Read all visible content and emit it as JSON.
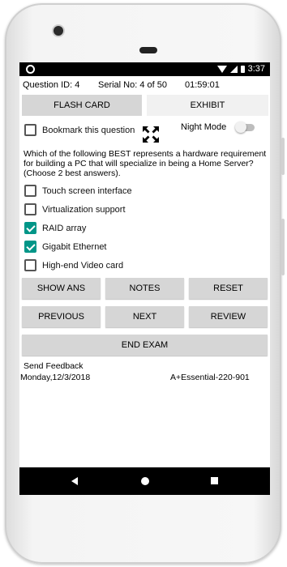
{
  "status_bar": {
    "time": "3:37"
  },
  "info": {
    "question_id": "Question ID: 4",
    "serial_no": "Serial No: 4 of 50",
    "timer": "01:59:01"
  },
  "tabs": {
    "flash_card": "FLASH CARD",
    "exhibit": "EXHIBIT"
  },
  "bookmark": {
    "label": "Bookmark this question",
    "checked": false
  },
  "night_mode": {
    "label": "Night Mode",
    "enabled": false
  },
  "question": {
    "text": "Which of the following BEST represents a hardware requirement for building a PC that will specialize in being a Home Server? (Choose 2 best answers)."
  },
  "options": [
    {
      "label": "Touch screen interface",
      "checked": false
    },
    {
      "label": "Virtualization support",
      "checked": false
    },
    {
      "label": "RAID array",
      "checked": true
    },
    {
      "label": "Gigabit Ethernet",
      "checked": true
    },
    {
      "label": "High-end Video card",
      "checked": false
    }
  ],
  "buttons": {
    "show_ans": "SHOW ANS",
    "notes": "NOTES",
    "reset": "RESET",
    "previous": "PREVIOUS",
    "next": "NEXT",
    "review": "REVIEW",
    "end_exam": "END EXAM"
  },
  "footer": {
    "feedback": "Send Feedback",
    "date": "Monday,12/3/2018",
    "exam_code": "A+Essential-220-901"
  },
  "colors": {
    "accent": "#009688",
    "button_bg": "#d6d6d6"
  }
}
